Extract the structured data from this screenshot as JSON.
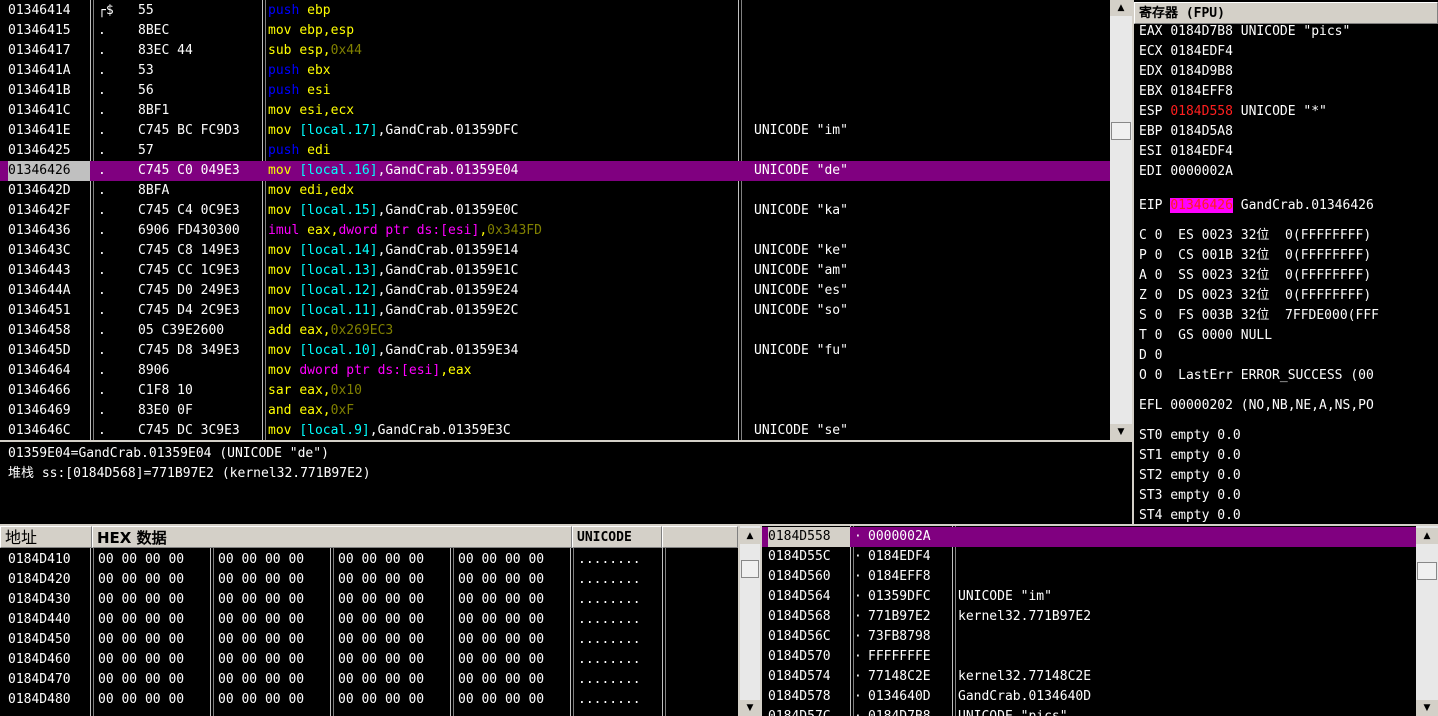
{
  "colors": {
    "mnem_push": "#0000ff",
    "mnem_default": "#ffff00",
    "mnem_mem": "#ff00ff",
    "operand_mem": "#00ffff",
    "hex_const": "#808000",
    "selection": "#800080",
    "eip_hl": "#ff00ff"
  },
  "disasm": {
    "rows": [
      {
        "addr": "01346414",
        "mark": "┌$",
        "hex": "55",
        "mn": "push",
        "segs": [
          {
            "t": "ebp",
            "c": "#ffff00"
          }
        ],
        "cmt": ""
      },
      {
        "addr": "01346415",
        "mark": ".",
        "hex": "8BEC",
        "mn": "mov",
        "segs": [
          {
            "t": "ebp,esp",
            "c": "#ffff00"
          }
        ],
        "cmt": ""
      },
      {
        "addr": "01346417",
        "mark": ".",
        "hex": "83EC 44",
        "mn": "sub",
        "segs": [
          {
            "t": "esp,",
            "c": "#ffff00"
          },
          {
            "t": "0x44",
            "c": "#808000"
          }
        ],
        "cmt": ""
      },
      {
        "addr": "0134641A",
        "mark": ".",
        "hex": "53",
        "mn": "push",
        "segs": [
          {
            "t": "ebx",
            "c": "#ffff00"
          }
        ],
        "cmt": ""
      },
      {
        "addr": "0134641B",
        "mark": ".",
        "hex": "56",
        "mn": "push",
        "segs": [
          {
            "t": "esi",
            "c": "#ffff00"
          }
        ],
        "cmt": ""
      },
      {
        "addr": "0134641C",
        "mark": ".",
        "hex": "8BF1",
        "mn": "mov",
        "segs": [
          {
            "t": "esi,ecx",
            "c": "#ffff00"
          }
        ],
        "cmt": ""
      },
      {
        "addr": "0134641E",
        "mark": ".",
        "hex": "C745 BC FC9D3",
        "mn": "mov",
        "segs": [
          {
            "t": "[local.17]",
            "c": "#00ffff"
          },
          {
            "t": ",GandCrab.01359DFC",
            "c": "#ffffff"
          }
        ],
        "cmt": "UNICODE \"im\""
      },
      {
        "addr": "01346425",
        "mark": ".",
        "hex": "57",
        "mn": "push",
        "segs": [
          {
            "t": "edi",
            "c": "#ffff00"
          }
        ],
        "cmt": ""
      },
      {
        "addr": "01346426",
        "mark": ".",
        "hex": "C745 C0 049E3",
        "mn": "mov",
        "segs": [
          {
            "t": "[local.16]",
            "c": "#00ffff"
          },
          {
            "t": ",GandCrab.01359E04",
            "c": "#ffffff"
          }
        ],
        "cmt": "UNICODE \"de\"",
        "sel": true
      },
      {
        "addr": "0134642D",
        "mark": ".",
        "hex": "8BFA",
        "mn": "mov",
        "segs": [
          {
            "t": "edi,edx",
            "c": "#ffff00"
          }
        ],
        "cmt": ""
      },
      {
        "addr": "0134642F",
        "mark": ".",
        "hex": "C745 C4 0C9E3",
        "mn": "mov",
        "segs": [
          {
            "t": "[local.15]",
            "c": "#00ffff"
          },
          {
            "t": ",GandCrab.01359E0C",
            "c": "#ffffff"
          }
        ],
        "cmt": "UNICODE \"ka\""
      },
      {
        "addr": "01346436",
        "mark": ".",
        "hex": "6906 FD430300",
        "mn": "imul",
        "segs": [
          {
            "t": "eax,",
            "c": "#ffff00"
          },
          {
            "t": "dword ptr ds:[esi]",
            "c": "#ff00ff"
          },
          {
            "t": ",",
            "c": "#ffff00"
          },
          {
            "t": "0x343FD",
            "c": "#808000"
          }
        ],
        "cmt": ""
      },
      {
        "addr": "0134643C",
        "mark": ".",
        "hex": "C745 C8 149E3",
        "mn": "mov",
        "segs": [
          {
            "t": "[local.14]",
            "c": "#00ffff"
          },
          {
            "t": ",GandCrab.01359E14",
            "c": "#ffffff"
          }
        ],
        "cmt": "UNICODE \"ke\""
      },
      {
        "addr": "01346443",
        "mark": ".",
        "hex": "C745 CC 1C9E3",
        "mn": "mov",
        "segs": [
          {
            "t": "[local.13]",
            "c": "#00ffff"
          },
          {
            "t": ",GandCrab.01359E1C",
            "c": "#ffffff"
          }
        ],
        "cmt": "UNICODE \"am\""
      },
      {
        "addr": "0134644A",
        "mark": ".",
        "hex": "C745 D0 249E3",
        "mn": "mov",
        "segs": [
          {
            "t": "[local.12]",
            "c": "#00ffff"
          },
          {
            "t": ",GandCrab.01359E24",
            "c": "#ffffff"
          }
        ],
        "cmt": "UNICODE \"es\""
      },
      {
        "addr": "01346451",
        "mark": ".",
        "hex": "C745 D4 2C9E3",
        "mn": "mov",
        "segs": [
          {
            "t": "[local.11]",
            "c": "#00ffff"
          },
          {
            "t": ",GandCrab.01359E2C",
            "c": "#ffffff"
          }
        ],
        "cmt": "UNICODE \"so\""
      },
      {
        "addr": "01346458",
        "mark": ".",
        "hex": "05 C39E2600",
        "mn": "add",
        "segs": [
          {
            "t": "eax,",
            "c": "#ffff00"
          },
          {
            "t": "0x269EC3",
            "c": "#808000"
          }
        ],
        "cmt": ""
      },
      {
        "addr": "0134645D",
        "mark": ".",
        "hex": "C745 D8 349E3",
        "mn": "mov",
        "segs": [
          {
            "t": "[local.10]",
            "c": "#00ffff"
          },
          {
            "t": ",GandCrab.01359E34",
            "c": "#ffffff"
          }
        ],
        "cmt": "UNICODE \"fu\""
      },
      {
        "addr": "01346464",
        "mark": ".",
        "hex": "8906",
        "mn": "mov",
        "segs": [
          {
            "t": "dword ptr ds:[esi]",
            "c": "#ff00ff"
          },
          {
            "t": ",eax",
            "c": "#ffff00"
          }
        ],
        "cmt": ""
      },
      {
        "addr": "01346466",
        "mark": ".",
        "hex": "C1F8 10",
        "mn": "sar",
        "segs": [
          {
            "t": "eax,",
            "c": "#ffff00"
          },
          {
            "t": "0x10",
            "c": "#808000"
          }
        ],
        "cmt": ""
      },
      {
        "addr": "01346469",
        "mark": ".",
        "hex": "83E0 0F",
        "mn": "and",
        "segs": [
          {
            "t": "eax,",
            "c": "#ffff00"
          },
          {
            "t": "0xF",
            "c": "#808000"
          }
        ],
        "cmt": ""
      },
      {
        "addr": "0134646C",
        "mark": ".",
        "hex": "C745 DC 3C9E3",
        "mn": "mov",
        "segs": [
          {
            "t": "[local.9]",
            "c": "#00ffff"
          },
          {
            "t": ",GandCrab.01359E3C",
            "c": "#ffffff"
          }
        ],
        "cmt": "UNICODE \"se\""
      }
    ]
  },
  "info": {
    "line1": "01359E04=GandCrab.01359E04 (UNICODE \"de\")",
    "line2": "堆栈 ss:[0184D568]=771B97E2 (kernel32.771B97E2)"
  },
  "registers": {
    "title": "寄存器 (FPU)",
    "gp": [
      {
        "name": "EAX",
        "val": "0184D7B8",
        "note": "UNICODE \"pics\""
      },
      {
        "name": "ECX",
        "val": "0184EDF4",
        "note": ""
      },
      {
        "name": "EDX",
        "val": "0184D9B8",
        "note": ""
      },
      {
        "name": "EBX",
        "val": "0184EFF8",
        "note": ""
      },
      {
        "name": "ESP",
        "val": "0184D558",
        "note": "UNICODE \"*\"",
        "changed": true
      },
      {
        "name": "EBP",
        "val": "0184D5A8",
        "note": ""
      },
      {
        "name": "ESI",
        "val": "0184EDF4",
        "note": ""
      },
      {
        "name": "EDI",
        "val": "0000002A",
        "note": ""
      }
    ],
    "eip": {
      "name": "EIP",
      "val": "01346426",
      "note": "GandCrab.01346426"
    },
    "flags": [
      "C 0  ES 0023 32位  0(FFFFFFFF)",
      "P 0  CS 001B 32位  0(FFFFFFFF)",
      "A 0  SS 0023 32位  0(FFFFFFFF)",
      "Z 0  DS 0023 32位  0(FFFFFFFF)",
      "S 0  FS 003B 32位  7FFDE000(FFF",
      "T 0  GS 0000 NULL",
      "D 0",
      "O 0  LastErr ERROR_SUCCESS (00"
    ],
    "efl": "EFL 00000202 (NO,NB,NE,A,NS,PO",
    "fpu": [
      "ST0 empty 0.0",
      "ST1 empty 0.0",
      "ST2 empty 0.0",
      "ST3 empty 0.0",
      "ST4 empty 0.0"
    ]
  },
  "dump": {
    "headers": {
      "addr": "地址",
      "hex": "HEX 数据",
      "text": "UNICODE"
    },
    "rows": [
      {
        "addr": "0184D410",
        "bytes": [
          "00 00 00 00",
          "00 00 00 00",
          "00 00 00 00",
          "00 00 00 00"
        ],
        "text": "........"
      },
      {
        "addr": "0184D420",
        "bytes": [
          "00 00 00 00",
          "00 00 00 00",
          "00 00 00 00",
          "00 00 00 00"
        ],
        "text": "........"
      },
      {
        "addr": "0184D430",
        "bytes": [
          "00 00 00 00",
          "00 00 00 00",
          "00 00 00 00",
          "00 00 00 00"
        ],
        "text": "........"
      },
      {
        "addr": "0184D440",
        "bytes": [
          "00 00 00 00",
          "00 00 00 00",
          "00 00 00 00",
          "00 00 00 00"
        ],
        "text": "........"
      },
      {
        "addr": "0184D450",
        "bytes": [
          "00 00 00 00",
          "00 00 00 00",
          "00 00 00 00",
          "00 00 00 00"
        ],
        "text": "........"
      },
      {
        "addr": "0184D460",
        "bytes": [
          "00 00 00 00",
          "00 00 00 00",
          "00 00 00 00",
          "00 00 00 00"
        ],
        "text": "........"
      },
      {
        "addr": "0184D470",
        "bytes": [
          "00 00 00 00",
          "00 00 00 00",
          "00 00 00 00",
          "00 00 00 00"
        ],
        "text": "........"
      },
      {
        "addr": "0184D480",
        "bytes": [
          "00 00 00 00",
          "00 00 00 00",
          "00 00 00 00",
          "00 00 00 00"
        ],
        "text": "........"
      }
    ]
  },
  "stack": {
    "rows": [
      {
        "addr": "0184D558",
        "val": "0000002A",
        "cmt": "",
        "sel": true
      },
      {
        "addr": "0184D55C",
        "val": "0184EDF4",
        "cmt": ""
      },
      {
        "addr": "0184D560",
        "val": "0184EFF8",
        "cmt": ""
      },
      {
        "addr": "0184D564",
        "val": "01359DFC",
        "cmt": "UNICODE \"im\""
      },
      {
        "addr": "0184D568",
        "val": "771B97E2",
        "cmt": "kernel32.771B97E2"
      },
      {
        "addr": "0184D56C",
        "val": "73FB8798",
        "cmt": ""
      },
      {
        "addr": "0184D570",
        "val": "FFFFFFFE",
        "cmt": ""
      },
      {
        "addr": "0184D574",
        "val": "77148C2E",
        "cmt": "kernel32.77148C2E"
      },
      {
        "addr": "0184D578",
        "val": "0134640D",
        "cmt": "GandCrab.0134640D"
      },
      {
        "addr": "0184D57C",
        "val": "0184D7B8",
        "cmt": "UNICODE \"pics\""
      }
    ]
  }
}
